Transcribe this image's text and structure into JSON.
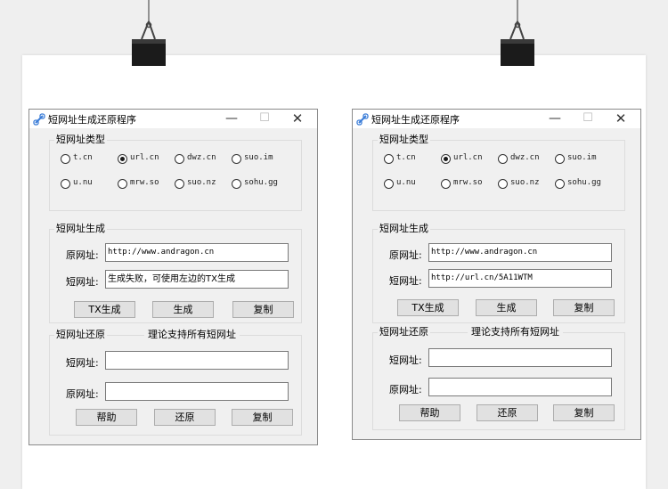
{
  "windows": [
    {
      "title": "短网址生成还原程序",
      "controls": {
        "minimize": "—",
        "maximize": "☐",
        "close": "✕"
      },
      "type_group": {
        "legend": "短网址类型",
        "options": [
          "t.cn",
          "url.cn",
          "dwz.cn",
          "suo.im",
          "u.nu",
          "mrw.so",
          "suo.nz",
          "sohu.gg"
        ],
        "selected": "url.cn"
      },
      "generate_group": {
        "legend": "短网址生成",
        "original_label": "原网址:",
        "original_value": "http://www.andragon.cn",
        "short_label": "短网址:",
        "short_value": "生成失败，可使用左边的TX生成",
        "buttons": [
          "TX生成",
          "生成",
          "复制"
        ]
      },
      "restore_group": {
        "legend": "短网址还原",
        "note": "理论支持所有短网址",
        "short_label": "短网址:",
        "short_value": "",
        "original_label": "原网址:",
        "original_value": "",
        "buttons": [
          "帮助",
          "还原",
          "复制"
        ]
      }
    },
    {
      "title": "短网址生成还原程序",
      "controls": {
        "minimize": "—",
        "maximize": "☐",
        "close": "✕"
      },
      "type_group": {
        "legend": "短网址类型",
        "options": [
          "t.cn",
          "url.cn",
          "dwz.cn",
          "suo.im",
          "u.nu",
          "mrw.so",
          "suo.nz",
          "sohu.gg"
        ],
        "selected": "url.cn"
      },
      "generate_group": {
        "legend": "短网址生成",
        "original_label": "原网址:",
        "original_value": "http://www.andragon.cn",
        "short_label": "短网址:",
        "short_value": "http://url.cn/5A11WTM",
        "buttons": [
          "TX生成",
          "生成",
          "复制"
        ]
      },
      "restore_group": {
        "legend": "短网址还原",
        "note": "理论支持所有短网址",
        "short_label": "短网址:",
        "short_value": "",
        "original_label": "原网址:",
        "original_value": "",
        "buttons": [
          "帮助",
          "还原",
          "复制"
        ]
      }
    }
  ]
}
